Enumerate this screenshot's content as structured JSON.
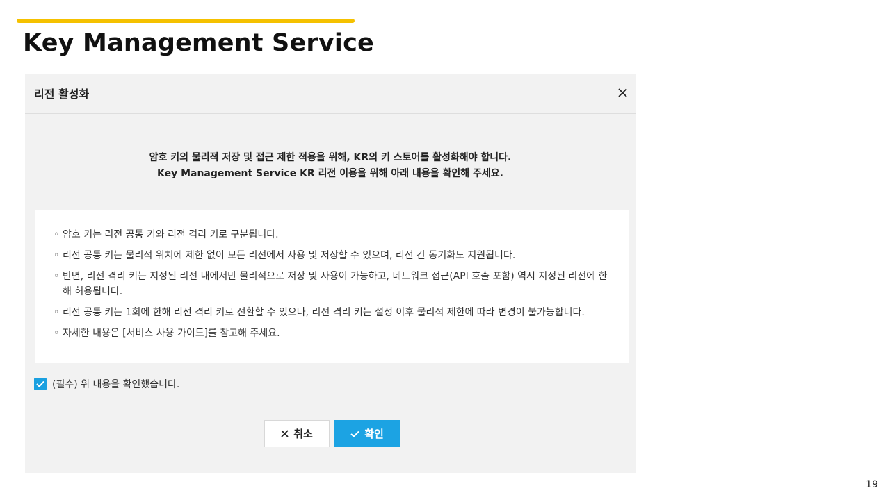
{
  "slide": {
    "title": "Key Management Service",
    "page_number": "19",
    "accent_color": "#f5c100"
  },
  "modal": {
    "title": "리전 활성화",
    "close_icon": "close-icon",
    "intro_line1": "암호 키의 물리적 저장 및 접근 제한 적용을 위해, KR의 키 스토어를 활성화해야 합니다.",
    "intro_line2": "Key Management Service KR 리전 이용을 위해 아래 내용을 확인해 주세요.",
    "info_items": [
      "암호 키는 리전 공통 키와 리전 격리 키로 구분됩니다.",
      "리전 공통 키는 물리적 위치에 제한 없이 모든 리전에서 사용 및 저장할 수 있으며, 리전 간 동기화도 지원됩니다.",
      "반면, 리전 격리 키는 지정된 리전 내에서만 물리적으로 저장 및 사용이 가능하고, 네트워크 접근(API 호출 포함) 역시 지정된 리전에 한해 허용됩니다.",
      "리전 공통 키는 1회에 한해 리전 격리 키로 전환할 수 있으나, 리전 격리 키는 설정 이후 물리적 제한에 따라 변경이 불가능합니다.",
      "자세한 내용은 [서비스 사용 가이드]를 참고해 주세요."
    ],
    "bullet": "◦",
    "consent_label": "(필수) 위 내용을 확인했습니다.",
    "consent_checked": true,
    "cancel_label": "취소",
    "confirm_label": "확인",
    "primary_color": "#1ca3e3"
  }
}
